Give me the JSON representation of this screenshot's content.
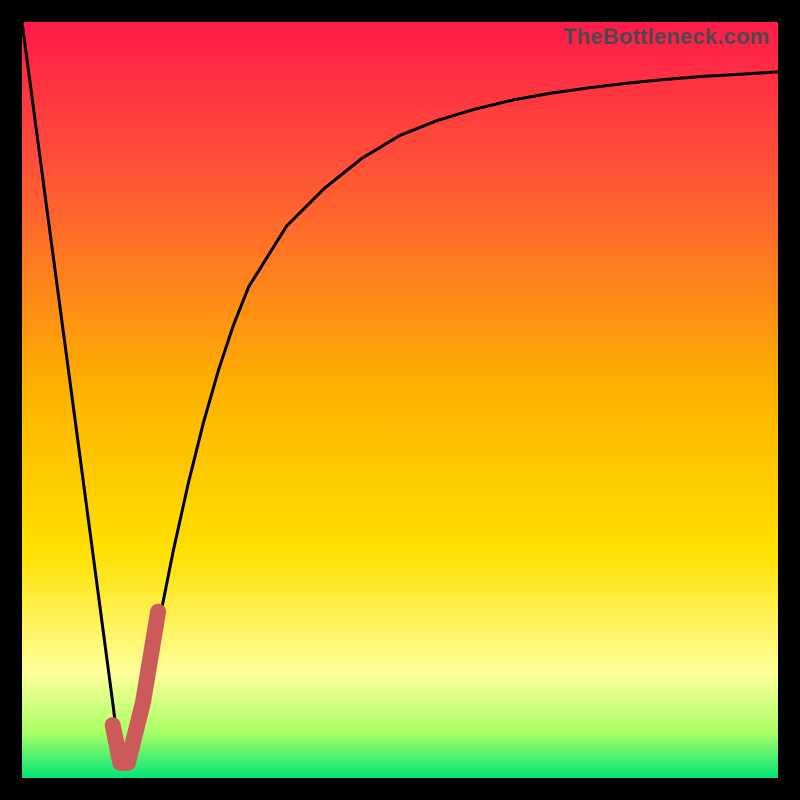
{
  "watermark": "TheBottleneck.com",
  "colors": {
    "frame": "#000000",
    "gradient_top": "#ff1a4a",
    "gradient_upper": "#ff5a34",
    "gradient_mid": "#ffb000",
    "gradient_lower": "#ffe000",
    "gradient_pale": "#ffff9a",
    "gradient_green1": "#aaff66",
    "gradient_green2": "#00e676",
    "curve_stroke": "#000000",
    "highlight_stroke": "#cc5a5a"
  },
  "chart_data": {
    "type": "line",
    "title": "",
    "xlabel": "",
    "ylabel": "",
    "xlim": [
      0,
      100
    ],
    "ylim": [
      0,
      100
    ],
    "series": [
      {
        "name": "bottleneck-curve",
        "x": [
          0,
          2,
          4,
          6,
          8,
          10,
          12,
          13,
          14,
          16,
          18,
          20,
          22,
          24,
          26,
          28,
          30,
          35,
          40,
          45,
          50,
          55,
          60,
          65,
          70,
          75,
          80,
          85,
          90,
          95,
          100
        ],
        "values": [
          100,
          85,
          70,
          55,
          40,
          25,
          10,
          2,
          2,
          10,
          20,
          30,
          39,
          47,
          54,
          60,
          65,
          73,
          78,
          82,
          85,
          87,
          88.5,
          89.7,
          90.6,
          91.3,
          91.9,
          92.4,
          92.8,
          93.1,
          93.4
        ]
      },
      {
        "name": "highlight-segment",
        "x": [
          12,
          13,
          14,
          16,
          18
        ],
        "values": [
          7,
          2,
          2,
          10,
          22
        ]
      }
    ]
  }
}
